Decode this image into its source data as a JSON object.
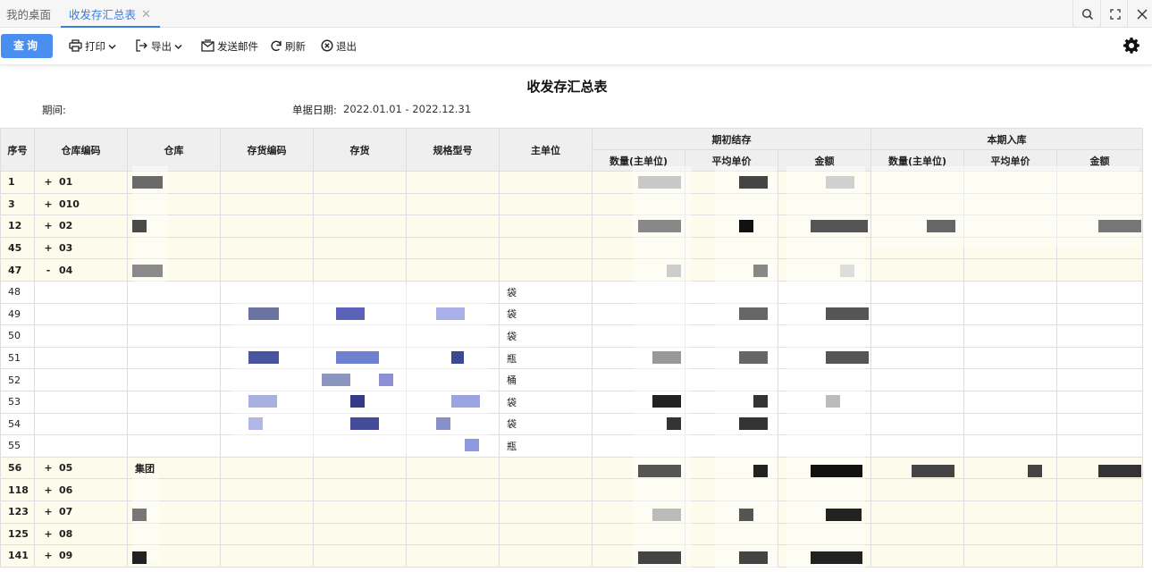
{
  "tabs": {
    "home": "我的桌面",
    "active": "收发存汇总表",
    "close": "✕"
  },
  "toolbar": {
    "query": "查询",
    "print": "打印",
    "export": "导出",
    "send_mail": "发送邮件",
    "refresh": "刷新",
    "exit": "退出"
  },
  "report": {
    "title": "收发存汇总表",
    "period_label": "期间:",
    "date_label": "单据日期:",
    "date_value": "2022.01.01 - 2022.12.31"
  },
  "columns": {
    "seq": "序号",
    "wh_code": "仓库编码",
    "warehouse": "仓库",
    "inv_code": "存货编码",
    "inventory": "存货",
    "spec": "规格型号",
    "unit": "主单位",
    "opening": "期初结存",
    "inbound": "本期入库",
    "qty": "数量(主单位)",
    "avg_price": "平均单价",
    "amount": "金额"
  },
  "rows": [
    {
      "seq": "1",
      "toggle": "+",
      "code": "01",
      "warehouse": "",
      "unit": "",
      "type": "group"
    },
    {
      "seq": "3",
      "toggle": "+",
      "code": "010",
      "warehouse": "",
      "unit": "",
      "type": "group"
    },
    {
      "seq": "12",
      "toggle": "+",
      "code": "02",
      "warehouse": "",
      "unit": "",
      "type": "group"
    },
    {
      "seq": "45",
      "toggle": "+",
      "code": "03",
      "warehouse": "",
      "unit": "",
      "type": "group"
    },
    {
      "seq": "47",
      "toggle": "-",
      "code": "04",
      "warehouse": "",
      "unit": "",
      "type": "group"
    },
    {
      "seq": "48",
      "toggle": "",
      "code": "",
      "warehouse": "",
      "unit": "袋",
      "type": "detail"
    },
    {
      "seq": "49",
      "toggle": "",
      "code": "",
      "warehouse": "",
      "unit": "袋",
      "type": "detail"
    },
    {
      "seq": "50",
      "toggle": "",
      "code": "",
      "warehouse": "",
      "unit": "袋",
      "type": "detail"
    },
    {
      "seq": "51",
      "toggle": "",
      "code": "",
      "warehouse": "",
      "unit": "瓶",
      "type": "detail"
    },
    {
      "seq": "52",
      "toggle": "",
      "code": "",
      "warehouse": "",
      "unit": "桶",
      "type": "detail"
    },
    {
      "seq": "53",
      "toggle": "",
      "code": "",
      "warehouse": "",
      "unit": "袋",
      "type": "detail"
    },
    {
      "seq": "54",
      "toggle": "",
      "code": "",
      "warehouse": "",
      "unit": "袋",
      "type": "detail"
    },
    {
      "seq": "55",
      "toggle": "",
      "code": "",
      "warehouse": "",
      "unit": "瓶",
      "type": "detail"
    },
    {
      "seq": "56",
      "toggle": "+",
      "code": "05",
      "warehouse": "集团",
      "unit": "",
      "type": "group"
    },
    {
      "seq": "118",
      "toggle": "+",
      "code": "06",
      "warehouse": "",
      "unit": "",
      "type": "group"
    },
    {
      "seq": "123",
      "toggle": "+",
      "code": "07",
      "warehouse": "",
      "unit": "",
      "type": "group"
    },
    {
      "seq": "125",
      "toggle": "+",
      "code": "08",
      "warehouse": "",
      "unit": "",
      "type": "group"
    },
    {
      "seq": "141",
      "toggle": "+",
      "code": "09",
      "warehouse": "",
      "unit": "",
      "type": "group"
    }
  ],
  "colors": {
    "accent": "#3a7de0",
    "query_button": "#4a8ff0",
    "group_row": "#fdfbeb",
    "header_bg": "#efefef"
  },
  "icons": [
    "search-icon",
    "fullscreen-icon",
    "close-icon",
    "printer-icon",
    "export-icon",
    "mail-icon",
    "refresh-icon",
    "exit-icon",
    "gear-icon"
  ]
}
